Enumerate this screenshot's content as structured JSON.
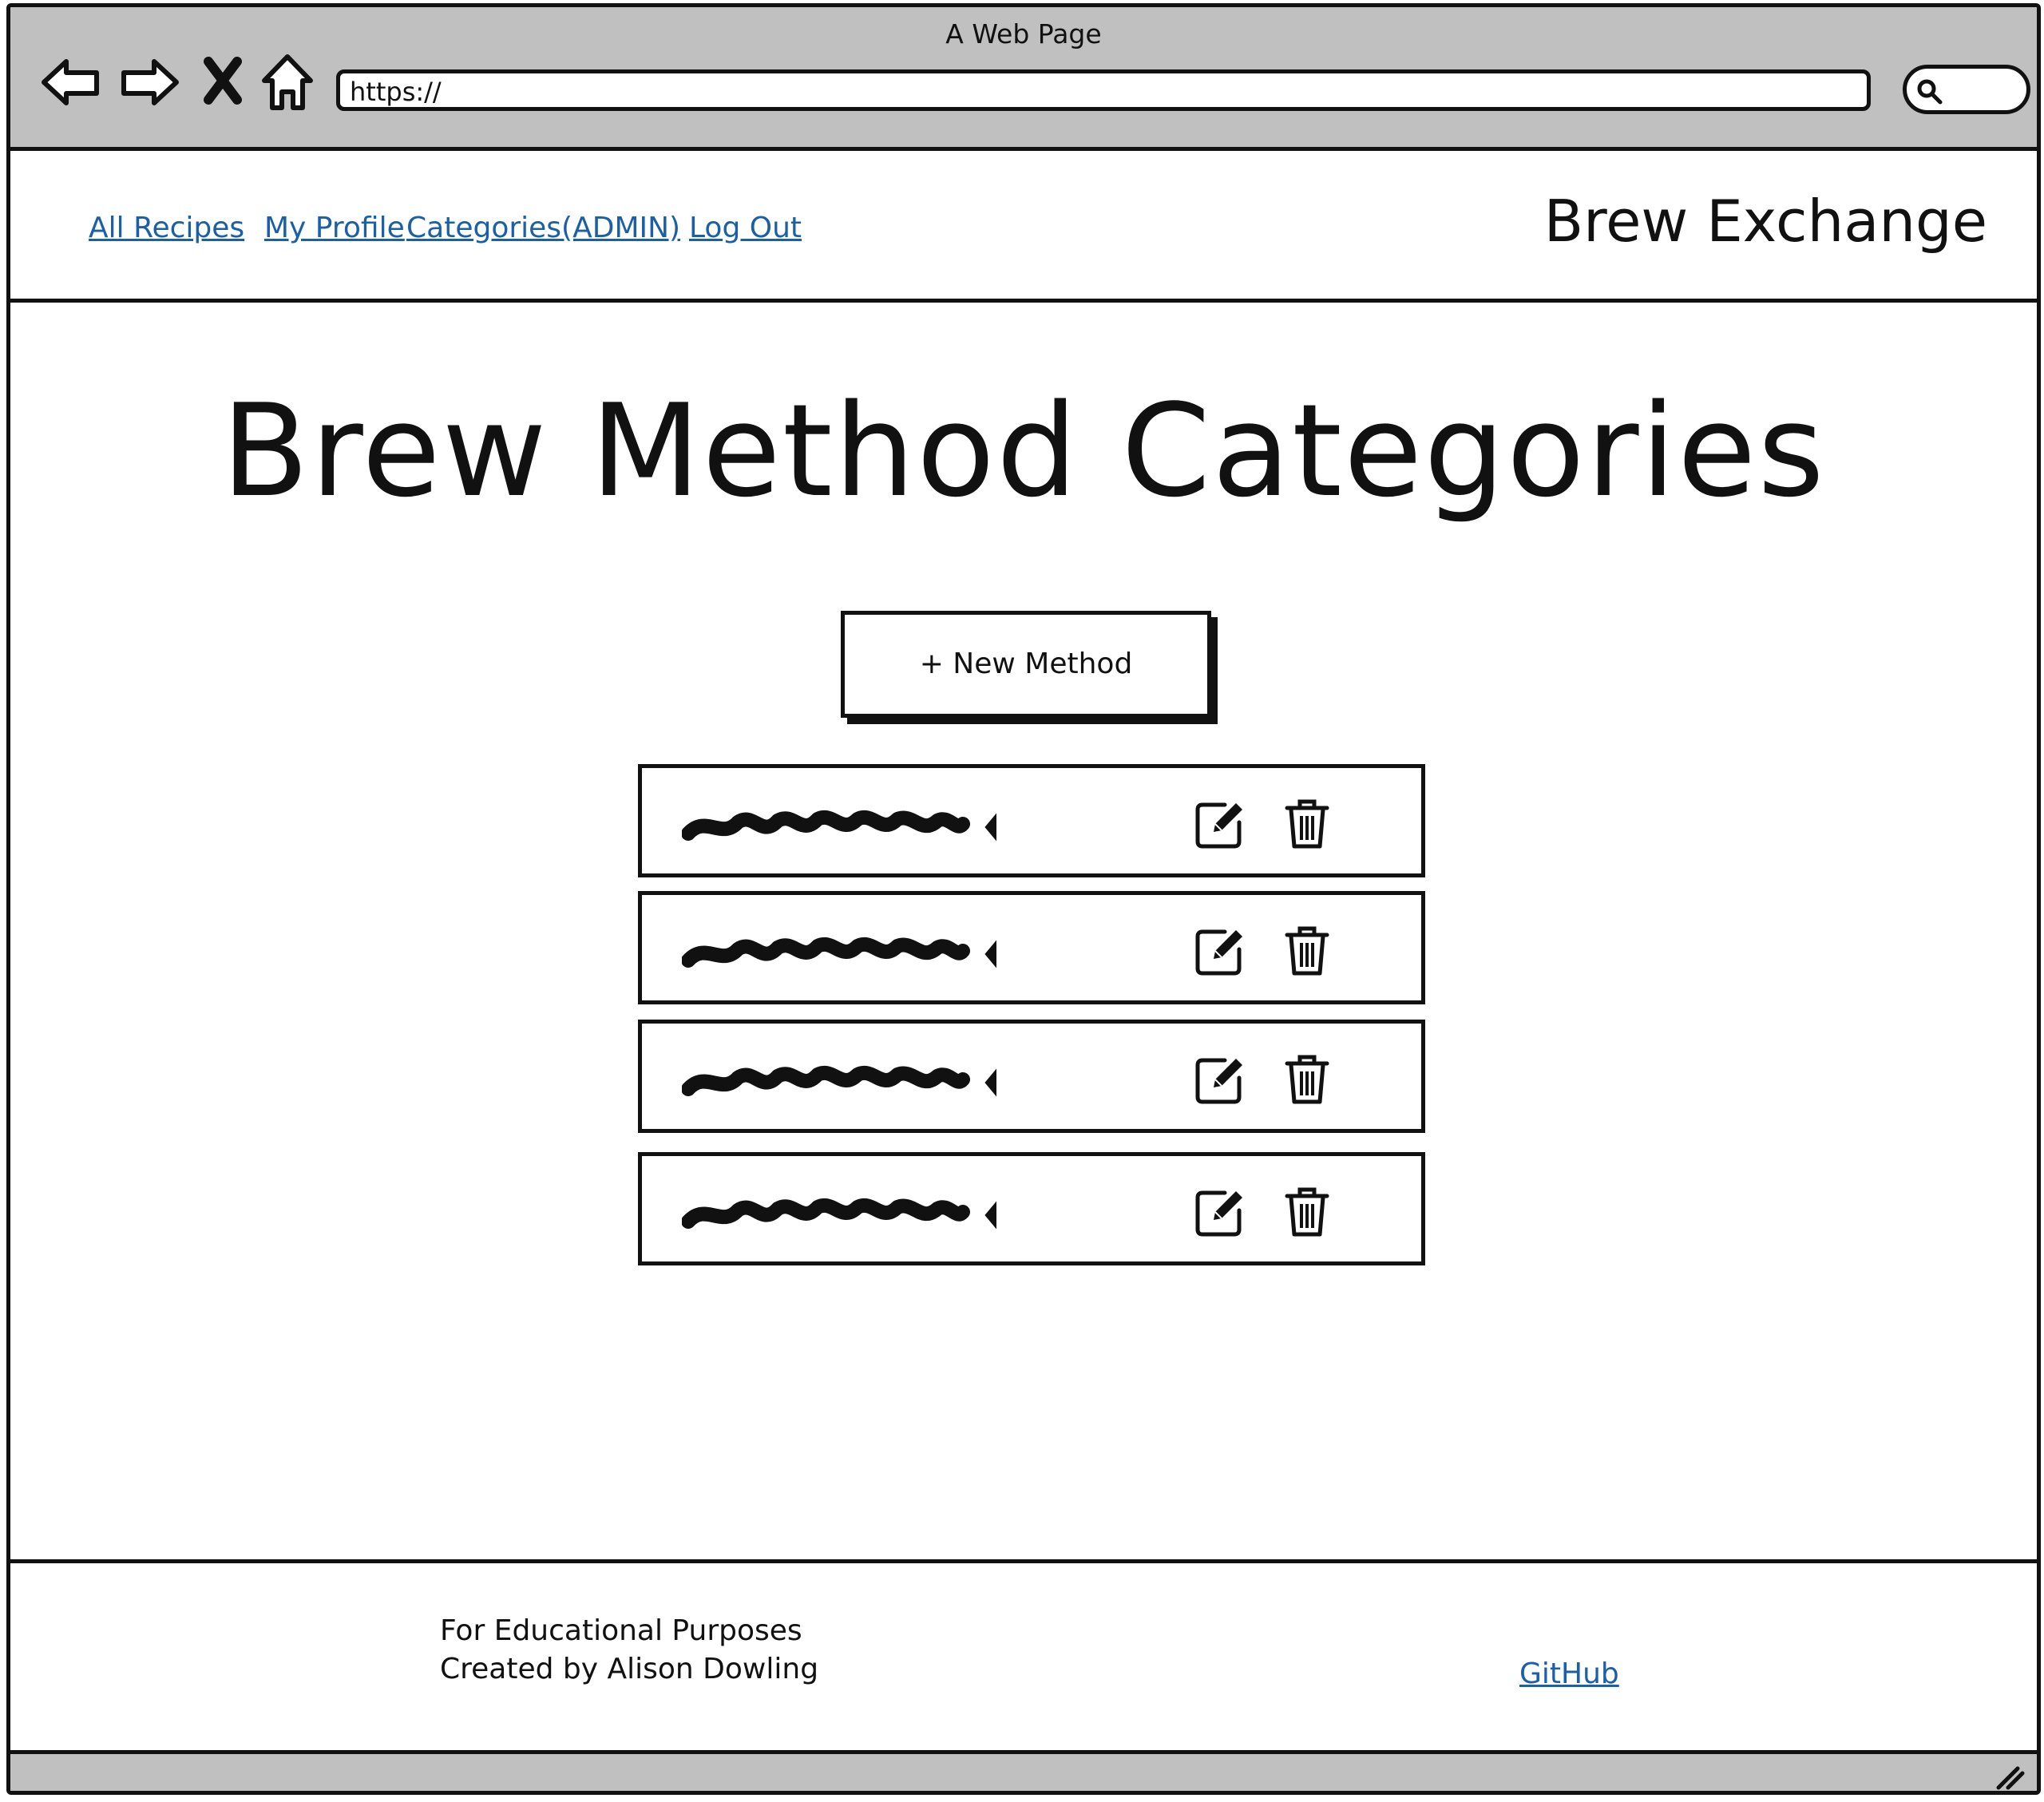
{
  "browser": {
    "window_title": "A Web Page",
    "url": "https://",
    "icons": [
      "back-arrow-icon",
      "forward-arrow-icon",
      "close-x-icon",
      "home-icon",
      "search-icon"
    ]
  },
  "header": {
    "nav": [
      {
        "label": "All Recipes"
      },
      {
        "label": "My Profile"
      },
      {
        "label": "Categories(ADMIN)"
      },
      {
        "label": "Log Out"
      }
    ],
    "brand": "Brew Exchange",
    "link_color": "#1a5fa8"
  },
  "main": {
    "title": "Brew Method Categories",
    "new_button_label": "+ New Method",
    "methods": [
      {
        "name": "",
        "edit_icon": "edit-icon",
        "delete_icon": "trash-icon"
      },
      {
        "name": "",
        "edit_icon": "edit-icon",
        "delete_icon": "trash-icon"
      },
      {
        "name": "",
        "edit_icon": "edit-icon",
        "delete_icon": "trash-icon"
      },
      {
        "name": "",
        "edit_icon": "edit-icon",
        "delete_icon": "trash-icon"
      }
    ]
  },
  "footer": {
    "line1": "For Educational Purposes",
    "line2": "Created by Alison Dowling",
    "github_label": "GitHub"
  }
}
